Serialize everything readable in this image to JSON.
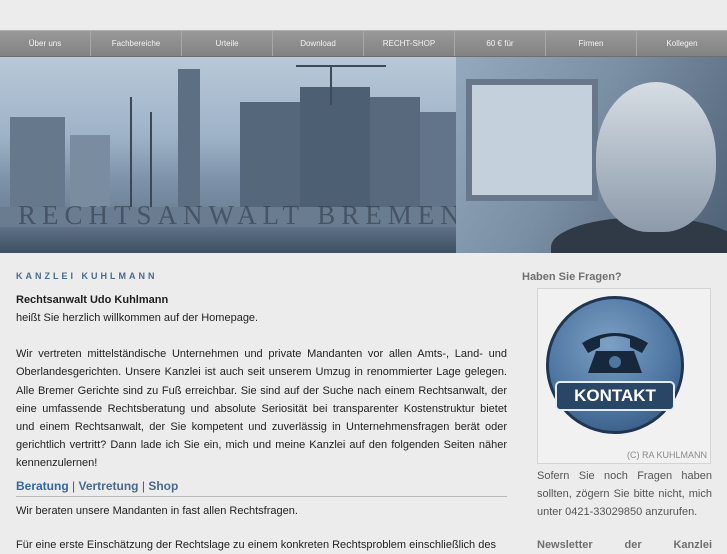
{
  "nav": {
    "items": [
      "Über uns",
      "Fachbereiche",
      "Urteile",
      "Download",
      "RECHT-SHOP",
      "60 € für",
      "Firmen",
      "Kollegen"
    ]
  },
  "banner": {
    "title": "RECHTSANWALT BREMEN"
  },
  "main": {
    "heading": "KANZLEI KUHLMANN",
    "lead": "Rechtsanwalt Udo Kuhlmann",
    "welcome": "heißt Sie herzlich willkommen auf der Homepage.",
    "intro": "Wir vertreten mittelständische Unternehmen und private Mandanten vor allen Amts-, Land- und Oberlandesgerichten. Unsere Kanzlei ist auch seit unserem Umzug in renommierter Lage gelegen. Alle Bremer Gerichte sind zu Fuß erreichbar. Sie sind auf der Suche nach einem Rechtsanwalt, der eine umfassende Rechtsberatung und absolute Seriosität bei transparenter Kostenstruktur bietet und einem Rechtsanwalt, der Sie kompetent und zuverlässig in Unternehmensfragen berät oder gerichtlich vertritt? Dann lade ich Sie ein, mich und meine Kanzlei auf den folgenden Seiten näher kennenzulernen!",
    "tabs": [
      "Beratung",
      "Vertretung",
      "Shop"
    ],
    "tab_separator": "|",
    "tab_text": "Wir beraten unsere Mandanten in fast allen Rechtsfragen.",
    "cut_text": "Für eine erste Einschätzung der Rechtslage zu einem konkreten Rechtsproblem einschließlich des"
  },
  "sidebar": {
    "heading": "Haben Sie Fragen?",
    "kontakt_label": "KONTAKT",
    "copyright": "(C) RA KUHLMANN",
    "text": "Sofern Sie noch Fragen haben sollten, zögern Sie bitte nicht, mich unter 0421-33029850 anzurufen.",
    "newsletter_heading": "Newsletter der Kanzlei"
  },
  "colors": {
    "accent": "#3266a8",
    "heading_blue": "#4a6a8c",
    "nav_bg": "#8c8c8c"
  }
}
